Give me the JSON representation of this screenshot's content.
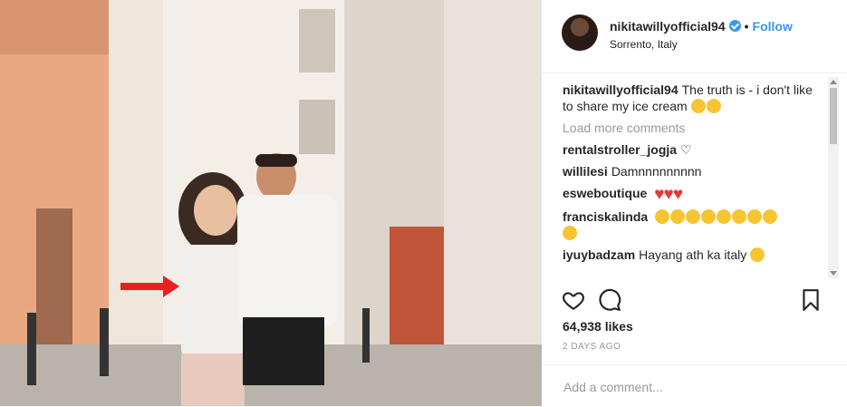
{
  "post": {
    "username": "nikitawillyofficial94",
    "follow_label": "Follow",
    "separator": "•",
    "location": "Sorrento, Italy",
    "caption_text": "The truth is - i don't like to share my ice cream",
    "load_more": "Load more comments",
    "likes": "64,938 likes",
    "timestamp": "2 DAYS AGO",
    "comment_placeholder": "Add a comment..."
  },
  "comments": [
    {
      "user": "rentalstroller_jogja",
      "text": "♡"
    },
    {
      "user": "willilesi",
      "text": "Damnnnnnnnnn"
    },
    {
      "user": "esweboutique",
      "text": ""
    },
    {
      "user": "franciskalinda",
      "text": ""
    },
    {
      "user": "iyuybadzam",
      "text": "Hayang ath ka italy"
    }
  ],
  "icons": [
    "heart-icon",
    "comment-icon",
    "bookmark-icon",
    "verified-badge-icon"
  ],
  "colors": {
    "link": "#3897f0",
    "text": "#262626",
    "muted": "#999999",
    "heart": "#e53935",
    "arrow": "#e82020"
  }
}
